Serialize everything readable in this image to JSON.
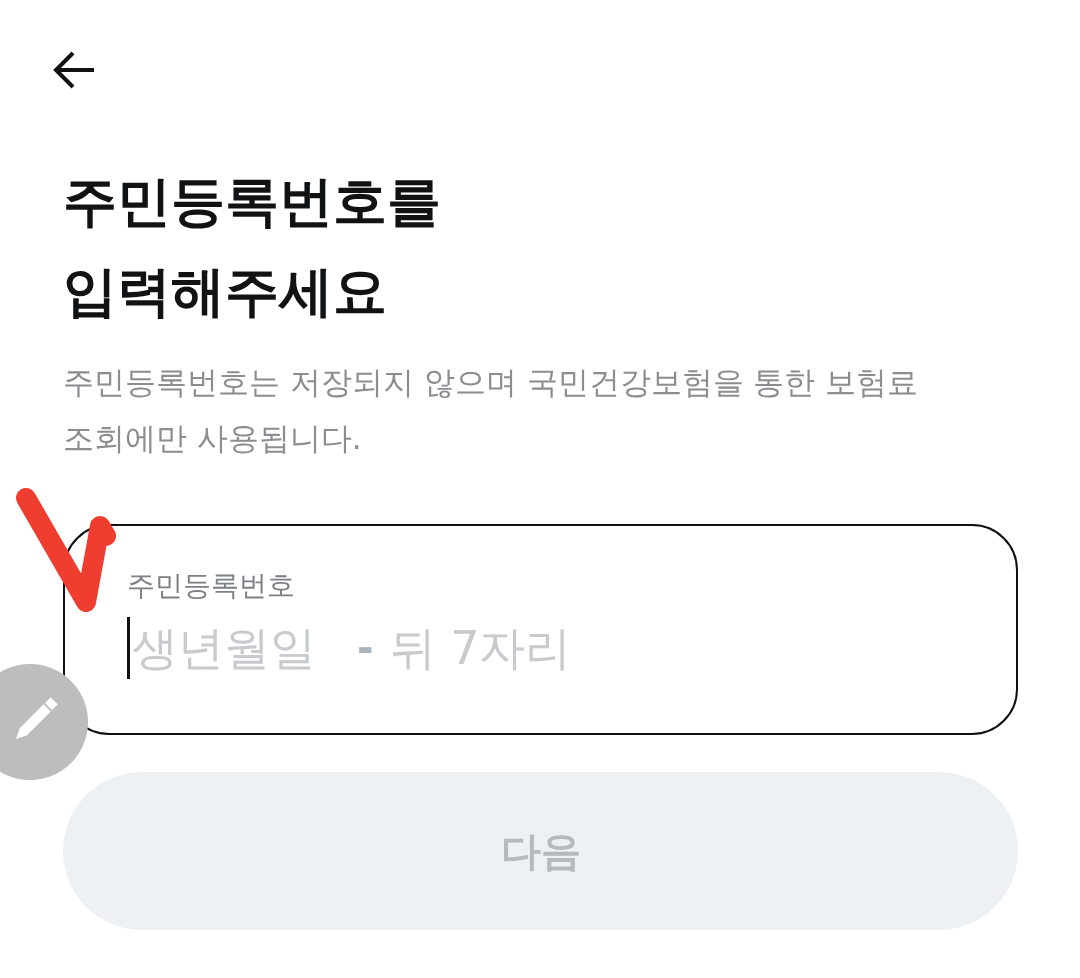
{
  "title": "주민등록번호를 입력해주세요",
  "description": "주민등록번호는 저장되지 않으며 국민건강보험을 통한 보험료 조회에만 사용됩니다.",
  "id_field": {
    "label": "주민등록번호",
    "inputs": [
      {
        "placeholder": "생년월일",
        "focused": true
      },
      {
        "placeholder": "뒤 7자리",
        "focused": false
      }
    ],
    "separator": "-"
  },
  "next_button": {
    "label": "다음",
    "disabled": true
  }
}
